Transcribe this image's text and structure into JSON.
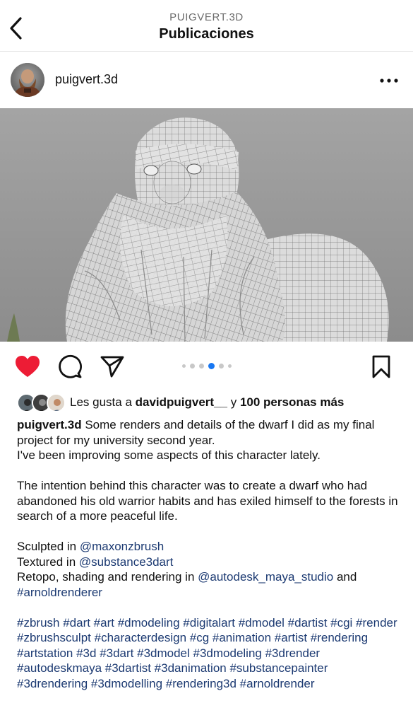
{
  "header": {
    "subtitle": "PUIGVERT.3D",
    "title": "Publicaciones"
  },
  "post": {
    "username": "puigvert.3d",
    "image_alt": "Wireframe render of a bearded dwarf character",
    "carousel": {
      "count": 6,
      "active_index": 3
    }
  },
  "likes": {
    "prefix": "Les gusta a ",
    "user": "davidpuigvert__",
    "middle": " y ",
    "others": "100 personas más"
  },
  "caption": {
    "username": "puigvert.3d",
    "line1": " Some renders and details of the dwarf I did as my final project for my university second year.",
    "line2": "I've been improving some aspects of this character lately.",
    "paragraph2": "The intention behind this character was to create a dwarf who had abandoned his old warrior habits and has exiled himself to the forests in search of a more peaceful life.",
    "sculpted_prefix": "Sculpted in ",
    "sculpted_mention": "@maxonzbrush",
    "textured_prefix": "Textured in ",
    "textured_mention": "@substance3dart",
    "retopo_prefix": "Retopo, shading and rendering in ",
    "retopo_mention1": "@autodesk_maya_studio",
    "retopo_and": " and",
    "retopo_mention2": "#arnoldrenderer",
    "hashtags": "#zbrush #dart #art #dmodeling #digitalart #dmodel #dartist #cgi #render #zbrushsculpt #characterdesign #cg #animation #artist #rendering #artstation #3d #3dart #3dmodel #3dmodeling #3drender #autodeskmaya #3dartist #3danimation #substancepainter #3drendering #3dmodelling #rendering3d #arnoldrender"
  },
  "colors": {
    "like_red": "#ed1c35",
    "carousel_active": "#1877f2",
    "link": "#1c3a72"
  }
}
